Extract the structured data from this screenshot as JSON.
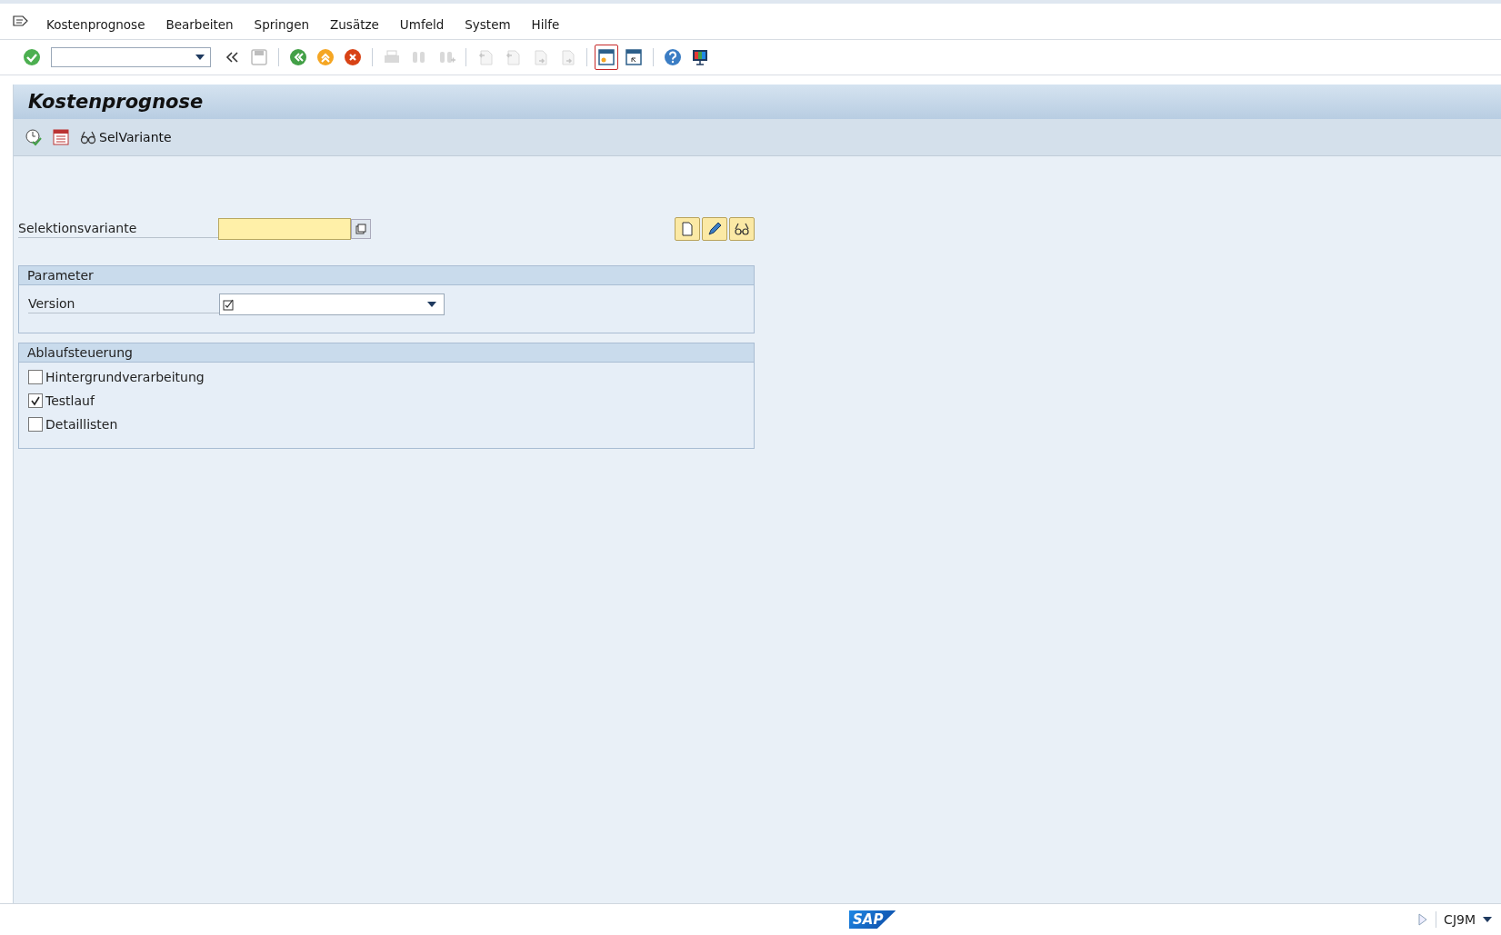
{
  "menu": [
    "Kostenprognose",
    "Bearbeiten",
    "Springen",
    "Zusätze",
    "Umfeld",
    "System",
    "Hilfe"
  ],
  "toolbar": [
    {
      "kind": "enter",
      "disabled": false
    },
    {
      "kind": "command-field"
    },
    {
      "kind": "collapse",
      "disabled": false
    },
    {
      "kind": "save",
      "disabled": true
    },
    {
      "kind": "separator"
    },
    {
      "kind": "back",
      "disabled": false
    },
    {
      "kind": "exit",
      "disabled": false
    },
    {
      "kind": "cancel",
      "disabled": false
    },
    {
      "kind": "separator"
    },
    {
      "kind": "print",
      "disabled": true
    },
    {
      "kind": "find",
      "disabled": true
    },
    {
      "kind": "find-next",
      "disabled": true
    },
    {
      "kind": "separator"
    },
    {
      "kind": "first-page",
      "disabled": true
    },
    {
      "kind": "prev-page",
      "disabled": true
    },
    {
      "kind": "next-page",
      "disabled": true
    },
    {
      "kind": "last-page",
      "disabled": true
    },
    {
      "kind": "separator"
    },
    {
      "kind": "new-session",
      "disabled": false,
      "selected": true
    },
    {
      "kind": "shortcut",
      "disabled": false,
      "selected": false
    },
    {
      "kind": "separator"
    },
    {
      "kind": "help",
      "disabled": false
    },
    {
      "kind": "layout",
      "disabled": false
    }
  ],
  "title": "Kostenprognose",
  "app_toolbar": [
    {
      "kind": "execute"
    },
    {
      "kind": "schedule"
    },
    {
      "kind": "variant",
      "label": "SelVariante"
    }
  ],
  "variant_field": {
    "label": "Selektionsvariante"
  },
  "variant_buttons": [
    {
      "kind": "create"
    },
    {
      "kind": "edit"
    },
    {
      "kind": "display"
    }
  ],
  "parameter_group": {
    "title": "Parameter",
    "fields": [
      {
        "label": "Version",
        "required": true
      }
    ]
  },
  "control_group": {
    "title": "Ablaufsteuerung",
    "checkboxes": [
      {
        "label": "Hintergrundverarbeitung",
        "checked": false
      },
      {
        "label": "Testlauf",
        "checked": true
      },
      {
        "label": "Detaillisten",
        "checked": false
      }
    ]
  },
  "status_bar": {
    "logo": "SAP",
    "transaction": "CJ9M"
  }
}
